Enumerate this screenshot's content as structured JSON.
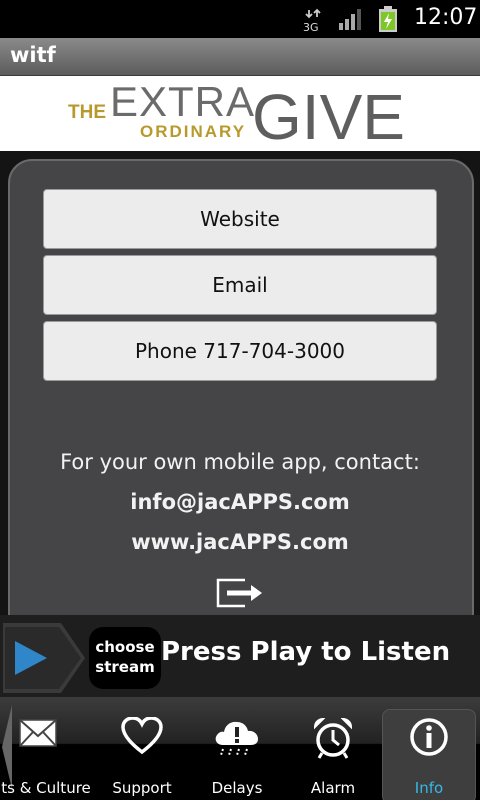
{
  "status_bar": {
    "network": "3G",
    "time": "12:07"
  },
  "app": {
    "title": "witf"
  },
  "banner": {
    "line1": "THE",
    "line2": "EXTRA",
    "line3": "ORDINARY",
    "line4": "GIVE"
  },
  "buttons": {
    "website": "Website",
    "email": "Email",
    "phone": "Phone 717-704-3000"
  },
  "contact": {
    "prompt": "For your own mobile app, contact:",
    "email": "info@jacAPPS.com",
    "website": "www.jacAPPS.com"
  },
  "player": {
    "choose_line1": "choose",
    "choose_line2": "stream",
    "label": "Press Play to Listen"
  },
  "tabs": [
    {
      "label": "ts & Culture",
      "icon": "envelope-icon"
    },
    {
      "label": "Support",
      "icon": "heart-icon"
    },
    {
      "label": "Delays",
      "icon": "alert-cloud-icon"
    },
    {
      "label": "Alarm",
      "icon": "alarm-clock-icon"
    },
    {
      "label": "Info",
      "icon": "info-icon",
      "active": true
    }
  ],
  "colors": {
    "active_tab": "#36b9e6",
    "panel": "#454547",
    "play_blue": "#2f86c8"
  }
}
